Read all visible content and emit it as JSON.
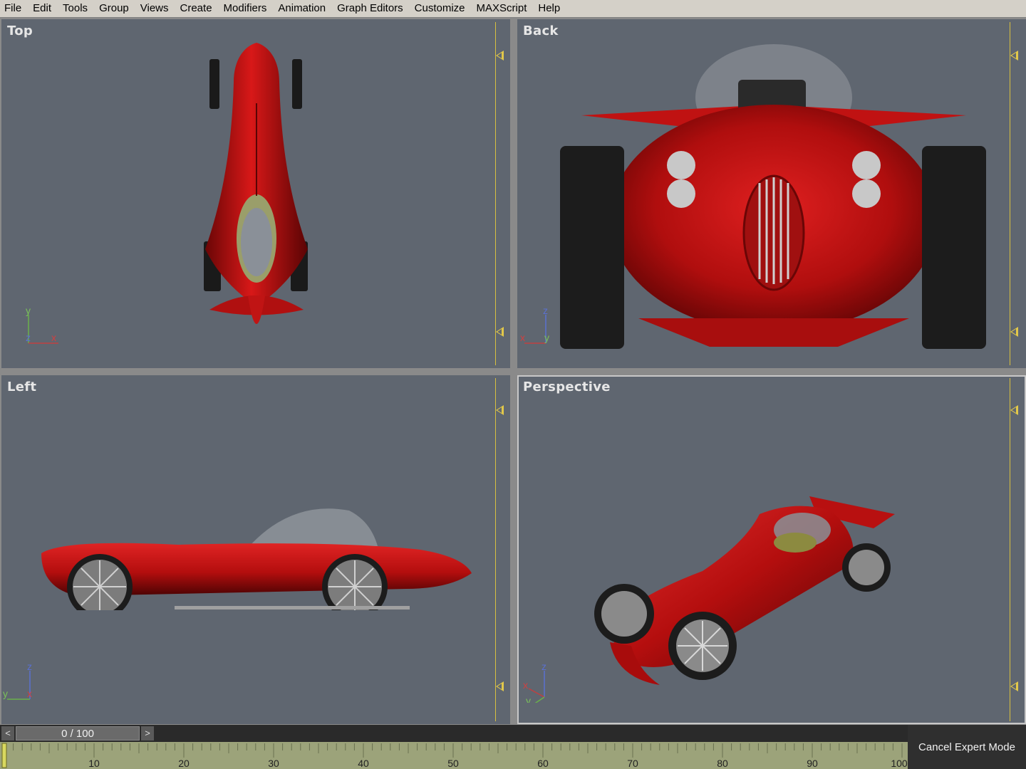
{
  "menubar": {
    "items": [
      "File",
      "Edit",
      "Tools",
      "Group",
      "Views",
      "Create",
      "Modifiers",
      "Animation",
      "Graph Editors",
      "Customize",
      "MAXScript",
      "Help"
    ]
  },
  "viewports": {
    "top": {
      "label": "Top",
      "axis": {
        "a": "y",
        "b": "z",
        "c": "x"
      }
    },
    "back": {
      "label": "Back",
      "axis": {
        "a": "z",
        "b": "x",
        "c": "y"
      }
    },
    "left": {
      "label": "Left",
      "axis": {
        "a": "z",
        "b": "y",
        "c": "x"
      }
    },
    "perspective": {
      "label": "Perspective",
      "axis": {
        "a": "z",
        "b": "x",
        "c": "y"
      }
    }
  },
  "timeline": {
    "frame_display": "0 / 100",
    "prev_label": "<",
    "next_label": ">",
    "ticks": [
      "10",
      "20",
      "30",
      "40",
      "50",
      "60",
      "70",
      "80",
      "90",
      "100"
    ]
  },
  "expert_mode": {
    "label": "Cancel Expert Mode"
  },
  "colors": {
    "viewport_bg": "#5f6670",
    "car_red": "#c01010",
    "safe_frame": "#e2c84a",
    "timeline_ruler": "#9ca37a"
  }
}
